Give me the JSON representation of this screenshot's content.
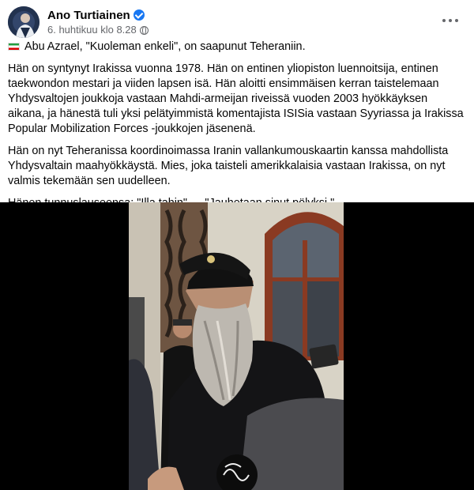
{
  "post": {
    "author": "Ano Turtiainen",
    "timestamp": "6. huhtikuu klo 8.28",
    "paragraphs": [
      "Abu Azrael, \"Kuoleman enkeli\", on saapunut Teheraniin.",
      "Hän on syntynyt Irakissa vuonna 1978. Hän on entinen yliopiston luennoitsija, entinen taekwondon mestari ja viiden lapsen isä. Hän aloitti ensimmäisen kerran taistelemaan Yhdysvaltojen joukkoja vastaan Mahdi-armeijan riveissä vuoden 2003 hyökkäyksen aikana, ja hänestä tuli yksi pelätyimmistä komentajista ISISia vastaan Syyriassa ja Irakissa Popular Mobilization Forces -joukkojen jäsenenä.",
      "Hän on nyt Teheranissa koordinoimassa Iranin vallankumouskaartin kanssa mahdollista Yhdysvaltain maahyökkäystä. Mies, joka taisteli amerikkalaisia vastaan Irakissa, on nyt valmis tekemään sen uudelleen.",
      "Hänen tunnuslauseensa: \"Illa tahin\" — \"Jauhetaan sinut pölyksi.\""
    ]
  },
  "icons": {
    "flag": "iran-flag-icon",
    "verified": "verified-badge-icon",
    "audience": "globe-icon",
    "menu": "more-options-icon"
  },
  "colors": {
    "verified": "#1877f2",
    "meta_text": "#65676b",
    "media_background": "#000000"
  }
}
